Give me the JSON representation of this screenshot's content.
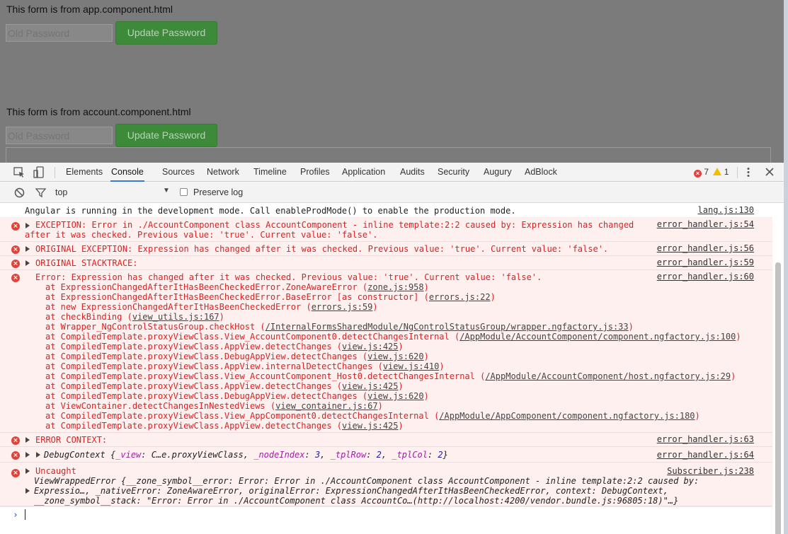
{
  "page": {
    "form1_title": "This form is from app.component.html",
    "form2_title": "This form is from account.component.html",
    "password_placeholder": "Old Password",
    "update_button": "Update Password"
  },
  "devtools": {
    "tabs": [
      "Elements",
      "Console",
      "Sources",
      "Network",
      "Timeline",
      "Profiles",
      "Application",
      "Audits",
      "Security",
      "Augury",
      "AdBlock"
    ],
    "active_tab": "Console",
    "error_count": "7",
    "warning_count": "1",
    "context": "top",
    "preserve_log": "Preserve log"
  },
  "console": {
    "info_text": "Angular is running in the development mode. Call enableProdMode() to enable the production mode.",
    "info_src": "lang.js:130",
    "m1_l1": "EXCEPTION: Error in ./AccountComponent class AccountComponent - inline template:2:2 caused by: Expression has changed",
    "m1_l2": "after it was checked. Previous value: 'true'. Current value: 'false'.",
    "m1_src": "error_handler.js:54",
    "m2_text": "ORIGINAL EXCEPTION: Expression has changed after it was checked. Previous value: 'true'. Current value: 'false'.",
    "m2_src": "error_handler.js:56",
    "m3_text": "ORIGINAL STACKTRACE:",
    "m3_src": "error_handler.js:59",
    "m4_text": "Error: Expression has changed after it was checked. Previous value: 'true'. Current value: 'false'.",
    "m4_src": "error_handler.js:60",
    "stack": [
      {
        "fn": "at ExpressionChangedAfterItHasBeenCheckedError.ZoneAwareError (",
        "loc": "zone.js:958",
        "end": ")"
      },
      {
        "fn": "at ExpressionChangedAfterItHasBeenCheckedError.BaseError [as constructor] (",
        "loc": "errors.js:22",
        "end": ")"
      },
      {
        "fn": "at new ExpressionChangedAfterItHasBeenCheckedError (",
        "loc": "errors.js:59",
        "end": ")"
      },
      {
        "fn": "at checkBinding (",
        "loc": "view_utils.js:167",
        "end": ")"
      },
      {
        "fn": "at Wrapper_NgControlStatusGroup.checkHost (",
        "loc": "/InternalFormsSharedModule/NgControlStatusGroup/wrapper.ngfactory.js:33",
        "end": ")"
      },
      {
        "fn": "at CompiledTemplate.proxyViewClass.View_AccountComponent0.detectChangesInternal (",
        "loc": "/AppModule/AccountComponent/component.ngfactory.js:100",
        "end": ")"
      },
      {
        "fn": "at CompiledTemplate.proxyViewClass.AppView.detectChanges (",
        "loc": "view.js:425",
        "end": ")"
      },
      {
        "fn": "at CompiledTemplate.proxyViewClass.DebugAppView.detectChanges (",
        "loc": "view.js:620",
        "end": ")"
      },
      {
        "fn": "at CompiledTemplate.proxyViewClass.AppView.internalDetectChanges (",
        "loc": "view.js:410",
        "end": ")"
      },
      {
        "fn": "at CompiledTemplate.proxyViewClass.View_AccountComponent_Host0.detectChangesInternal (",
        "loc": "/AppModule/AccountComponent/host.ngfactory.js:29",
        "end": ")"
      },
      {
        "fn": "at CompiledTemplate.proxyViewClass.AppView.detectChanges (",
        "loc": "view.js:425",
        "end": ")"
      },
      {
        "fn": "at CompiledTemplate.proxyViewClass.DebugAppView.detectChanges (",
        "loc": "view.js:620",
        "end": ")"
      },
      {
        "fn": "at ViewContainer.detectChangesInNestedViews (",
        "loc": "view_container.js:67",
        "end": ")"
      },
      {
        "fn": "at CompiledTemplate.proxyViewClass.View_AppComponent0.detectChangesInternal (",
        "loc": "/AppModule/AppComponent/component.ngfactory.js:180",
        "end": ")"
      },
      {
        "fn": "at CompiledTemplate.proxyViewClass.AppView.detectChanges (",
        "loc": "view.js:425",
        "end": ")"
      }
    ],
    "m5_text": "ERROR CONTEXT:",
    "m5_src": "error_handler.js:63",
    "m6_src": "error_handler.js:64",
    "m6_label": "DebugContext {",
    "m6_k1": "_view",
    "m6_v1": "C…e.proxyViewClass",
    "m6_k2": "_nodeIndex",
    "m6_v2": "3",
    "m6_k3": "_tplRow",
    "m6_v3": "2",
    "m6_k4": "_tplCol",
    "m6_v4": "2",
    "m7_text": "Uncaught",
    "m7_src": "Subscriber.js:238",
    "m7_l2": "ViewWrappedError {__zone_symbol__error: Error: Error in ./AccountComponent class AccountComponent - inline template:2:2 caused by:",
    "m7_l3": "Expressio…, _nativeError: ZoneAwareError, originalError: ExpressionChangedAfterItHasBeenCheckedError, context: DebugContext,",
    "m7_l4": "__zone_symbol__stack: \"Error: Error in ./AccountComponent class AccountCo…(http://localhost:4200/vendor.bundle.js:96805:18)\"…}"
  }
}
